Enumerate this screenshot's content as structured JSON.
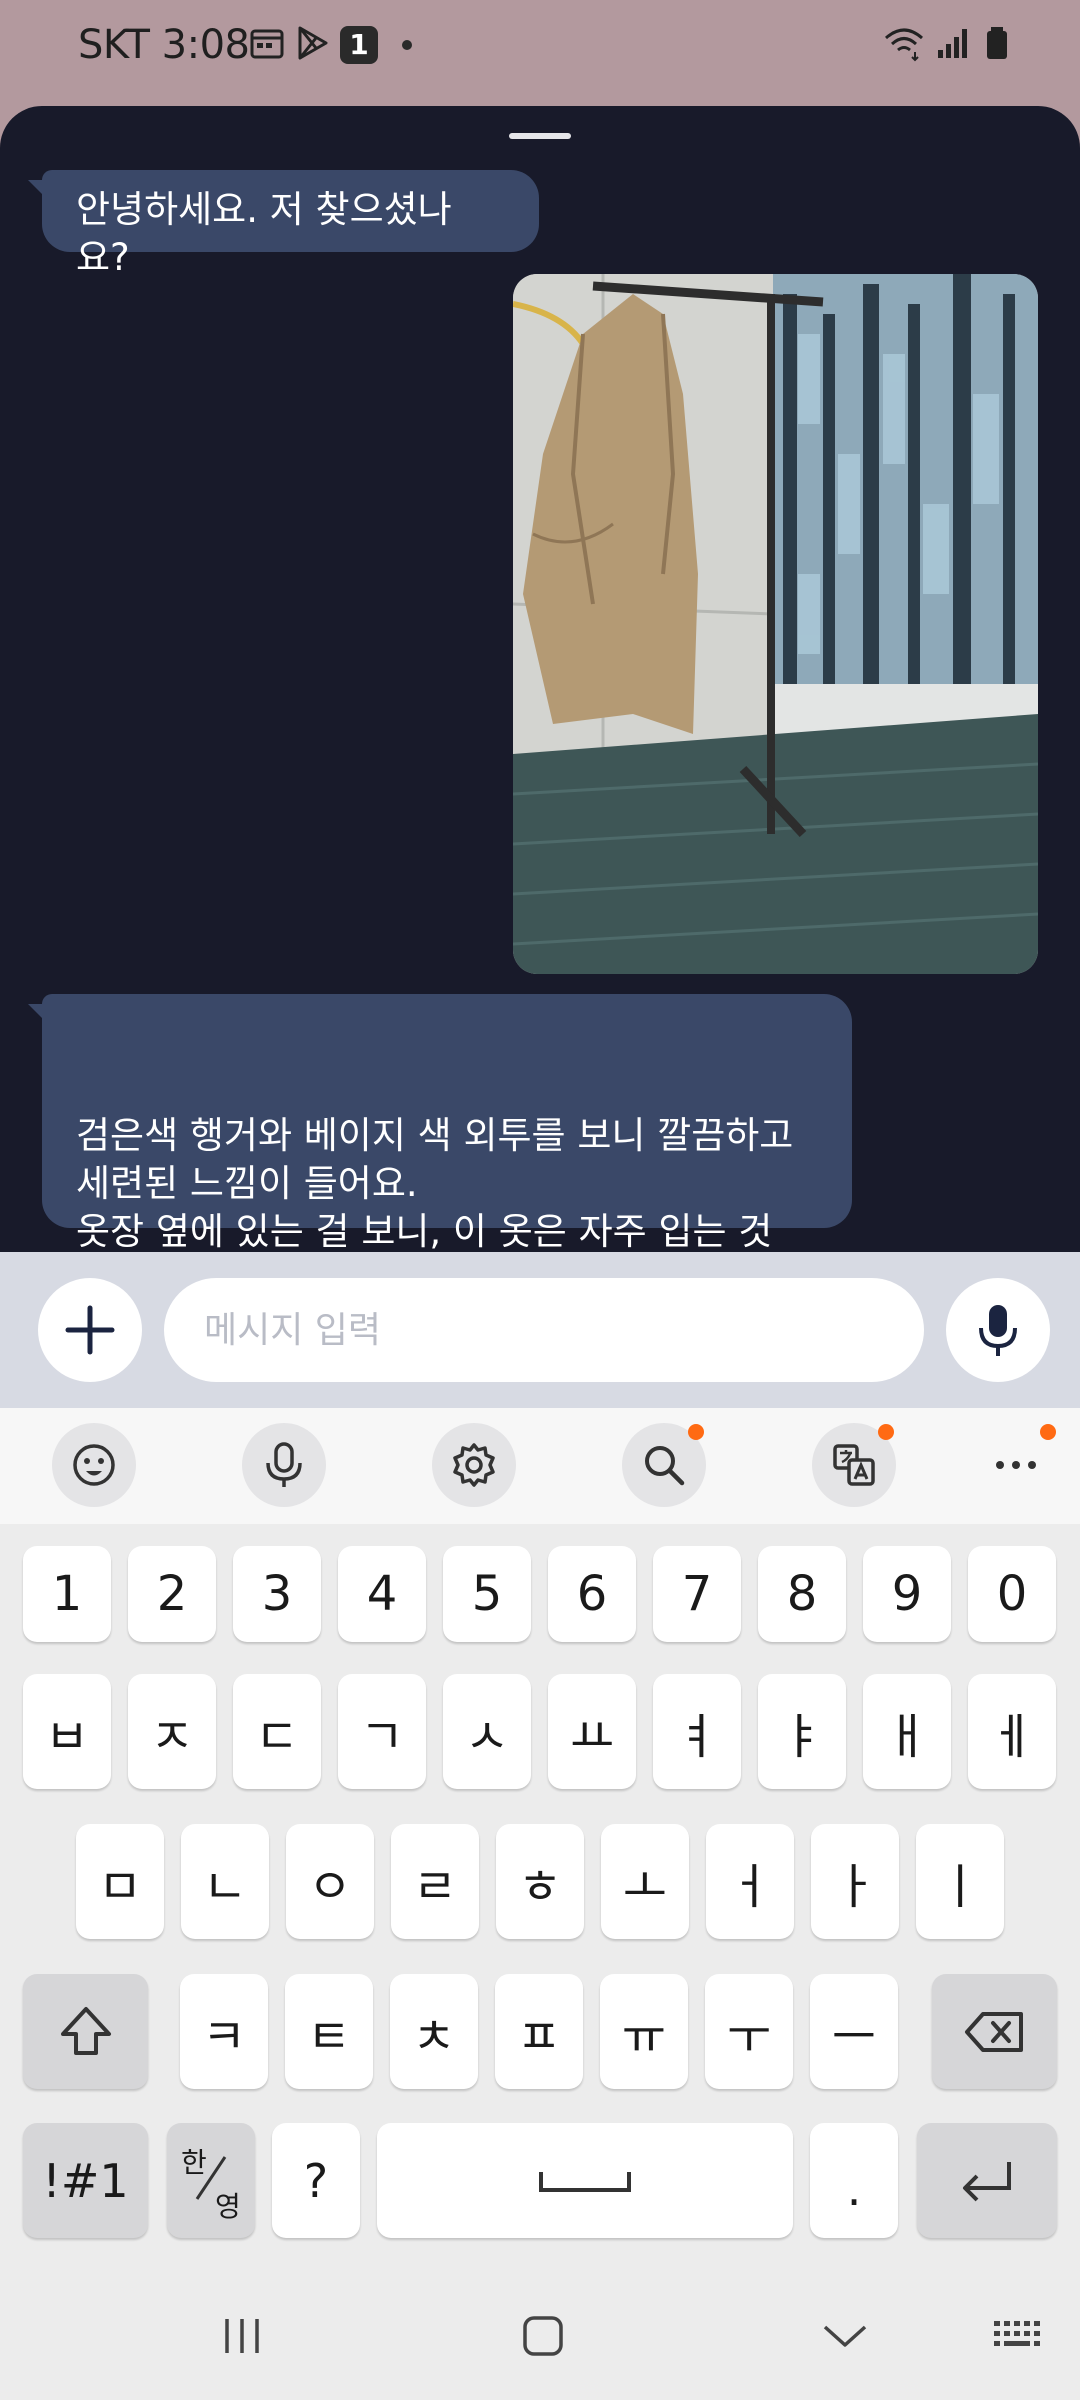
{
  "status_bar": {
    "carrier_time": "SKT 3:08",
    "notification_count": "1"
  },
  "chat": {
    "messages": [
      {
        "role": "assistant",
        "text": "안녕하세요. 저 찾으셨나요?"
      },
      {
        "role": "user",
        "type": "image"
      },
      {
        "role": "assistant",
        "text": "검은색 행거와 베이지 색 외투를 보니 깔끔하고\n세련된 느낌이 들어요.\n 옷장 옆에 있는 걸 보니, 이 옷은 자주 입는 것\n같아요."
      }
    ]
  },
  "input_bar": {
    "placeholder": "메시지 입력",
    "add_icon": "plus-icon",
    "voice_icon": "microphone-icon"
  },
  "keyboard": {
    "toolbar_icons": [
      "emoji-icon",
      "voice-input-icon",
      "settings-icon",
      "search-icon",
      "translate-icon",
      "more-icon"
    ],
    "toolbar_dots": [
      false,
      false,
      false,
      true,
      true,
      true
    ],
    "rows": [
      [
        "1",
        "2",
        "3",
        "4",
        "5",
        "6",
        "7",
        "8",
        "9",
        "0"
      ],
      [
        "ㅂ",
        "ㅈ",
        "ㄷ",
        "ㄱ",
        "ㅅ",
        "ㅛ",
        "ㅕ",
        "ㅑ",
        "ㅐ",
        "ㅔ"
      ],
      [
        "ㅁ",
        "ㄴ",
        "ㅇ",
        "ㄹ",
        "ㅎ",
        "ㅗ",
        "ㅓ",
        "ㅏ",
        "ㅣ"
      ],
      [
        "ㅋ",
        "ㅌ",
        "ㅊ",
        "ㅍ",
        "ㅠ",
        "ㅜ",
        "ㅡ"
      ]
    ],
    "symbols_key": "!#1",
    "lang_key_top": "한",
    "lang_key_bottom": "영",
    "question_key": "?",
    "period_key": "."
  },
  "colors": {
    "status_bg": "#b3999e",
    "chat_bg": "#181a2a",
    "bubble": "#3a4868",
    "accent_dot": "#ff6a13"
  }
}
